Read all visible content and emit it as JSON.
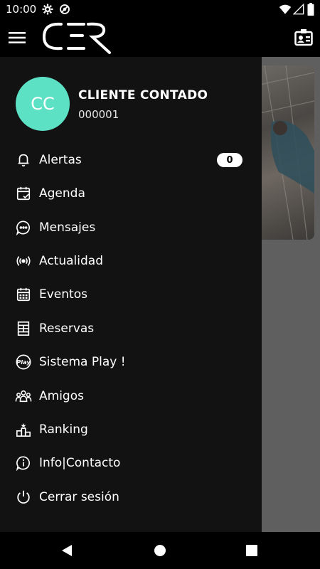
{
  "status_bar": {
    "time": "10:00"
  },
  "app_bar": {
    "logo_text": "CER"
  },
  "user": {
    "initials": "CC",
    "name": "CLIENTE CONTADO",
    "id": "000001",
    "avatar_color": "#5de1c5"
  },
  "menu": [
    {
      "label": "Alertas",
      "icon": "bell-icon",
      "badge": "0"
    },
    {
      "label": "Agenda",
      "icon": "calendar-check-icon"
    },
    {
      "label": "Mensajes",
      "icon": "chat-bubble-icon"
    },
    {
      "label": "Actualidad",
      "icon": "broadcast-icon"
    },
    {
      "label": "Eventos",
      "icon": "calendar-grid-icon"
    },
    {
      "label": "Reservas",
      "icon": "court-icon"
    },
    {
      "label": "Sistema Play !",
      "icon": "play-badge-icon"
    },
    {
      "label": "Amigos",
      "icon": "group-icon"
    },
    {
      "label": "Ranking",
      "icon": "podium-icon"
    },
    {
      "label": "Info|Contacto",
      "icon": "info-icon"
    },
    {
      "label": "Cerrar sesión",
      "icon": "power-icon"
    }
  ],
  "colors": {
    "drawer_bg": "#121212",
    "scrim": "#5f5f5f",
    "accent": "#5de1c5"
  }
}
